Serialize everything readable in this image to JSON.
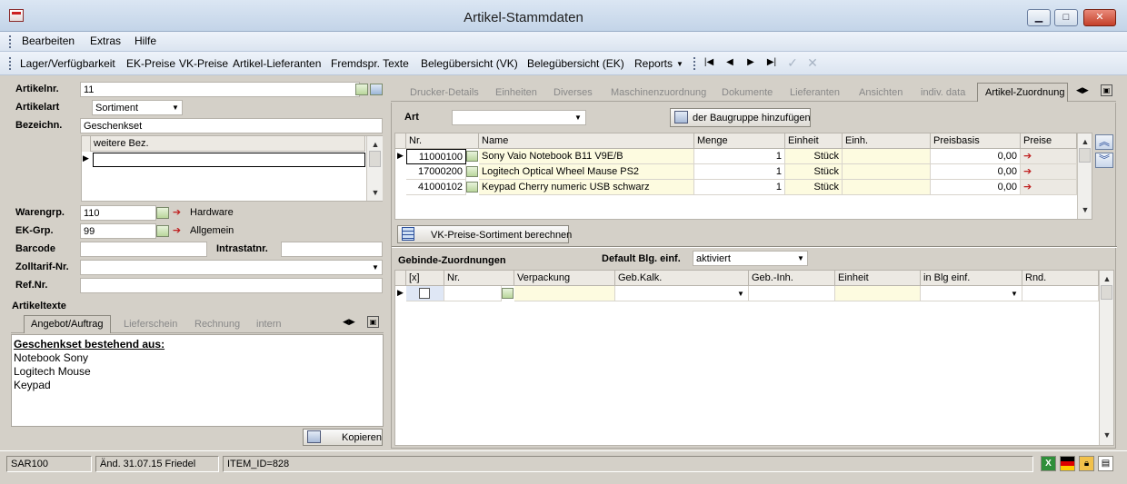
{
  "window": {
    "title": "Artikel-Stammdaten"
  },
  "menu": [
    {
      "label": "Bearbeiten"
    },
    {
      "label": "Extras"
    },
    {
      "label": "Hilfe"
    }
  ],
  "toolbar": {
    "items": [
      {
        "label": "Lager/Verfügbarkeit"
      },
      {
        "label": "EK-Preise"
      },
      {
        "label": "VK-Preise"
      },
      {
        "label": "Artikel-Lieferanten"
      },
      {
        "label": "Fremdspr. Texte"
      },
      {
        "label": "Belegübersicht (VK)"
      },
      {
        "label": "Belegübersicht (EK)"
      },
      {
        "label": "Reports"
      }
    ]
  },
  "article": {
    "nr_label": "Artikelnr.",
    "nr_value": "11",
    "art_label": "Artikelart",
    "art_value": "Sortiment",
    "bez_label": "Bezeichn.",
    "bez_value": "Geschenkset",
    "weitere_header": "weitere Bez.",
    "warengrp_label": "Warengrp.",
    "warengrp_value": "110",
    "warengrp_text": "Hardware",
    "ekgrp_label": "EK-Grp.",
    "ekgrp_value": "99",
    "ekgrp_text": "Allgemein",
    "barcode_label": "Barcode",
    "intrastat_label": "Intrastatnr.",
    "zoll_label": "Zolltarif-Nr.",
    "ref_label": "Ref.Nr.",
    "texte_label": "Artikeltexte"
  },
  "texttabs": [
    {
      "label": "Angebot/Auftrag"
    },
    {
      "label": "Lieferschein"
    },
    {
      "label": "Rechnung"
    },
    {
      "label": "intern"
    }
  ],
  "textbody": {
    "heading": "Geschenkset bestehend aus:",
    "lines": [
      "Notebook Sony",
      "Logitech Mouse",
      "Keypad"
    ],
    "copy_button": "Kopieren"
  },
  "righttabs": [
    {
      "label": "Drucker-Details"
    },
    {
      "label": "Einheiten"
    },
    {
      "label": "Diverses"
    },
    {
      "label": "Maschinenzuordnung"
    },
    {
      "label": "Dokumente"
    },
    {
      "label": "Lieferanten"
    },
    {
      "label": "Ansichten"
    },
    {
      "label": "indiv. data"
    },
    {
      "label": "Artikel-Zuordnung"
    }
  ],
  "zuordnung": {
    "art_label": "Art",
    "add_button": "der Baugruppe hinzufügen",
    "columns": [
      "Nr.",
      "Name",
      "Menge",
      "Einheit",
      "Einh.",
      "Preisbasis",
      "Preise"
    ],
    "rows": [
      {
        "nr": "11000100",
        "name": "Sony Vaio Notebook B11 V9E/B",
        "menge": "1",
        "einheit": "Stück",
        "preis": "0,00"
      },
      {
        "nr": "17000200",
        "name": "Logitech Optical Wheel Mause PS2",
        "menge": "1",
        "einheit": "Stück",
        "preis": "0,00"
      },
      {
        "nr": "41000102",
        "name": "Keypad Cherry numeric USB schwarz",
        "menge": "1",
        "einheit": "Stück",
        "preis": "0,00"
      }
    ],
    "vk_button": "VK-Preise-Sortiment berechnen"
  },
  "gebinde": {
    "label": "Gebinde-Zuordnungen",
    "default_label": "Default Blg. einf.",
    "default_value": "aktiviert",
    "columns": [
      "[x]",
      "Nr.",
      "Verpackung",
      "Geb.Kalk.",
      "Geb.-Inh.",
      "Einheit",
      "in Blg einf.",
      "Rnd."
    ]
  },
  "status": {
    "module": "SAR100",
    "changed": "Änd. 31.07.15 Friedel",
    "item": "ITEM_ID=828"
  }
}
